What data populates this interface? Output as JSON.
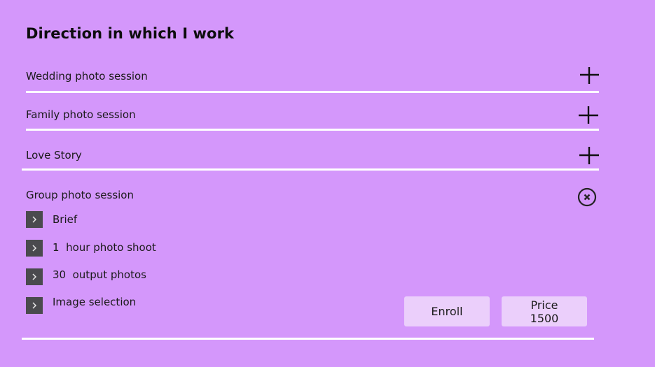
{
  "header": {
    "title": "Direction in which I work"
  },
  "sections": [
    {
      "label": "Wedding photo session",
      "state": "collapsed",
      "icon": "plus-icon"
    },
    {
      "label": "Family photo session",
      "state": "collapsed",
      "icon": "plus-icon"
    },
    {
      "label": "Love Story",
      "state": "collapsed",
      "icon": "plus-icon"
    },
    {
      "label": "Group photo session",
      "state": "expanded",
      "icon": "close-icon"
    }
  ],
  "group_session": {
    "items": [
      {
        "label": "Brief",
        "icon": "chevron-right-icon"
      },
      {
        "label": "1  hour photo shoot",
        "icon": "chevron-right-icon"
      },
      {
        "label": "30  output photos",
        "icon": "chevron-right-icon"
      },
      {
        "label": "Image selection",
        "icon": "chevron-right-icon"
      }
    ],
    "enroll_label": "Enroll",
    "price_label": "Price",
    "price_value": "1500"
  },
  "colors": {
    "background": "#d497fb",
    "divider": "#ffffff",
    "button_bg": "#ebcffb",
    "chevron_bg": "#4a4a4e"
  }
}
